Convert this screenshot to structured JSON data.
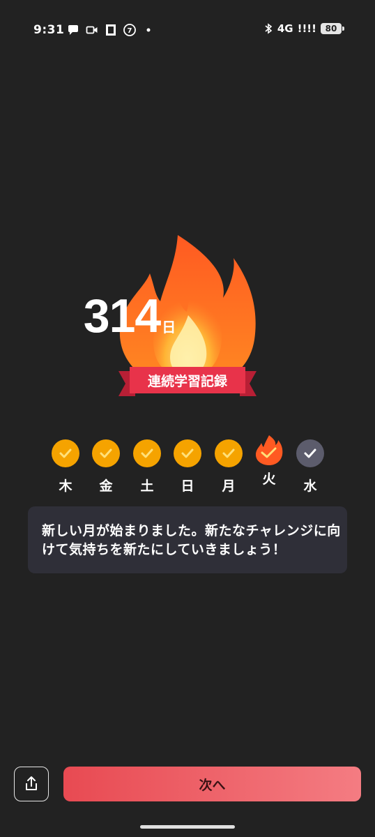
{
  "status_bar": {
    "time": "9:31",
    "network": "4G",
    "signal": "!!!!",
    "battery": "80"
  },
  "streak": {
    "count": "314",
    "unit": "日",
    "banner_label": "連続学習記録"
  },
  "week": [
    {
      "label": "木",
      "state": "done"
    },
    {
      "label": "金",
      "state": "done"
    },
    {
      "label": "土",
      "state": "done"
    },
    {
      "label": "日",
      "state": "done"
    },
    {
      "label": "月",
      "state": "done"
    },
    {
      "label": "火",
      "state": "today"
    },
    {
      "label": "水",
      "state": "pending"
    }
  ],
  "message": {
    "text": "新しい月が始まりました。新たなチャレンジに向けて気持ちを新たにしていきましょう！"
  },
  "footer": {
    "next_label": "次へ"
  },
  "colors": {
    "background": "#222222",
    "flame_outer": "#ff6a2a",
    "flame_inner": "#ffd86a",
    "ribbon": "#e8334a",
    "done": "#f5a300",
    "pending": "#5c5c6c",
    "next_button_start": "#e84a52",
    "next_button_end": "#f47c82"
  }
}
